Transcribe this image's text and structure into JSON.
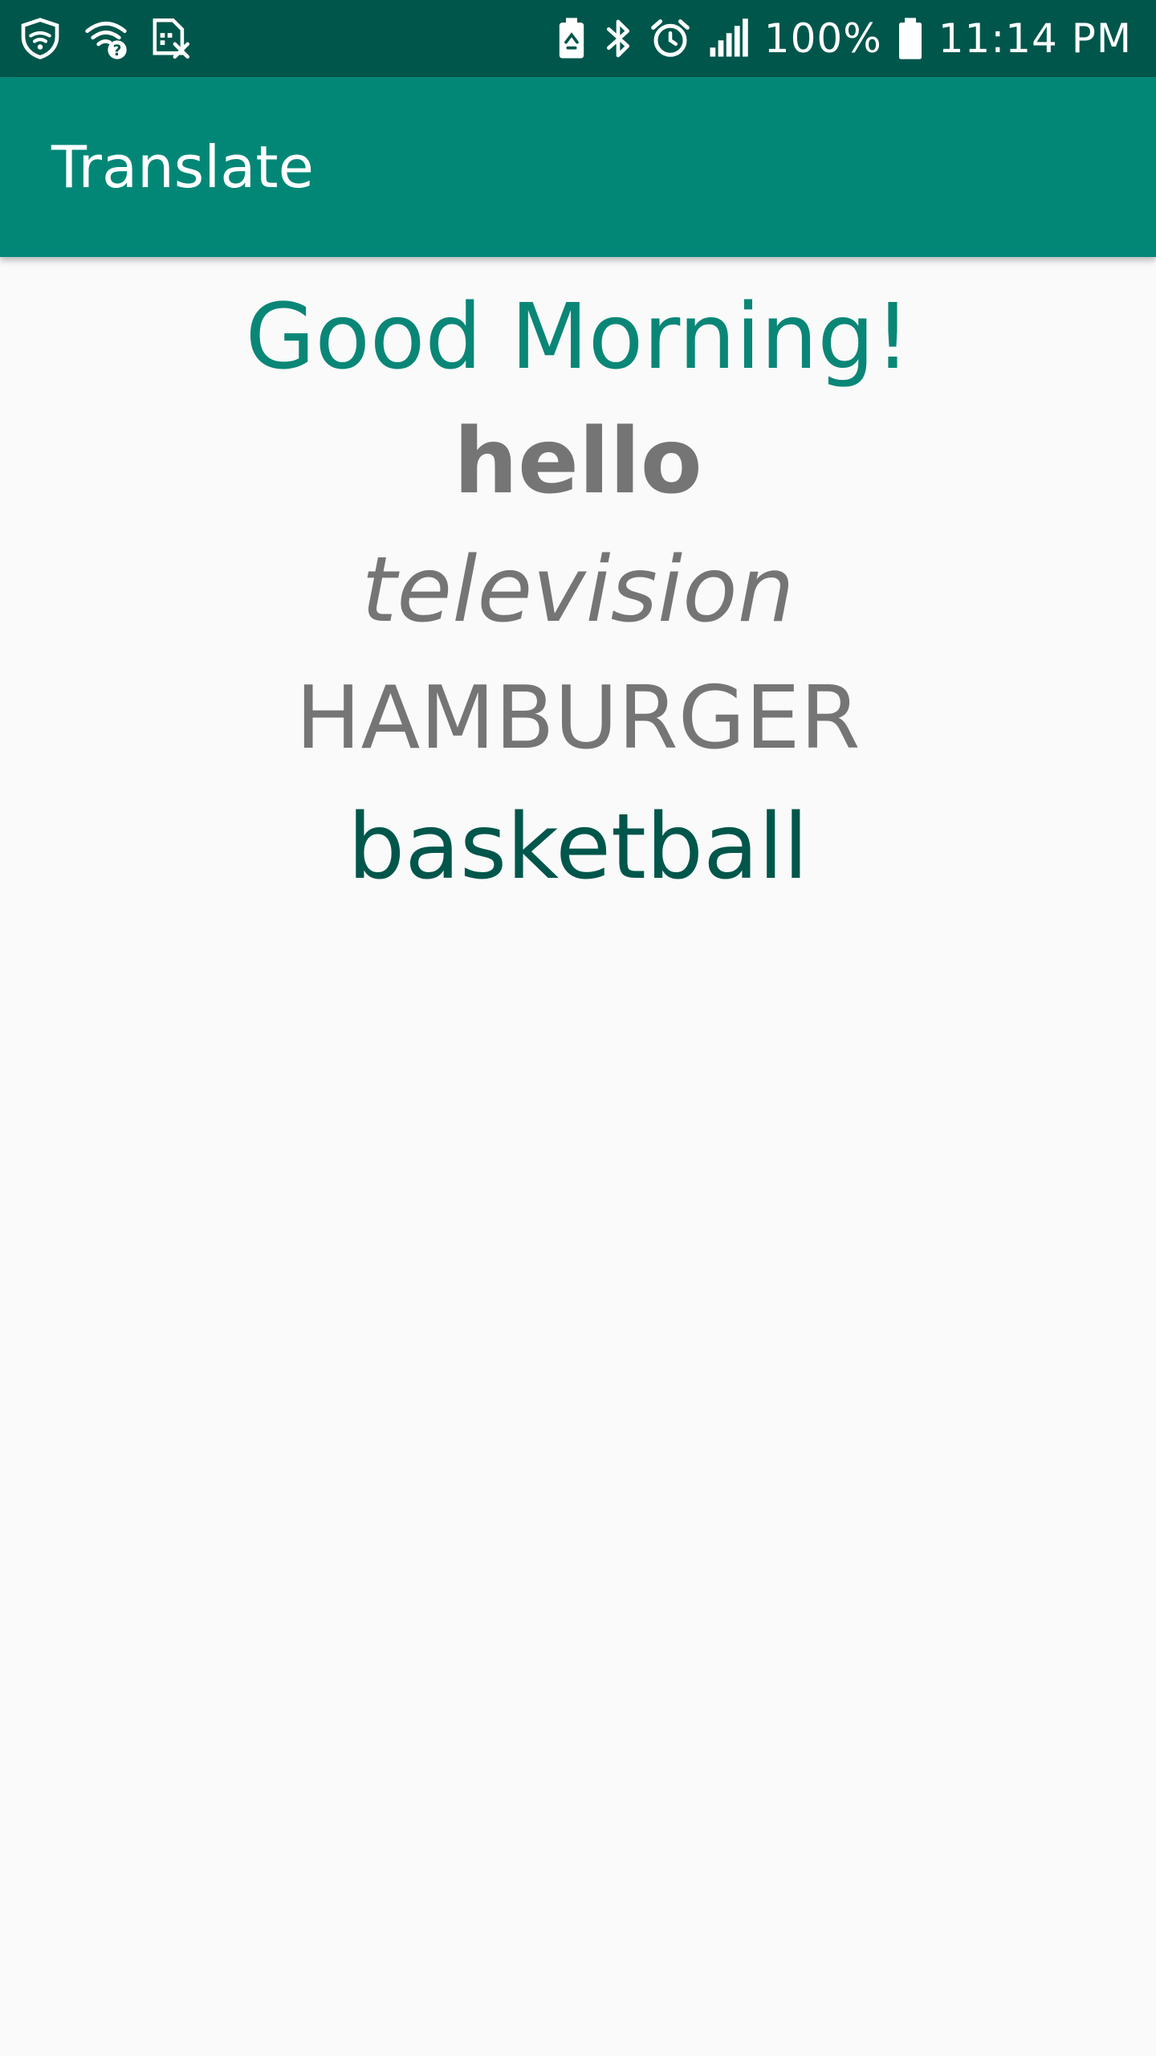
{
  "status_bar": {
    "left_icons": [
      "shield-icon",
      "wifi-question-icon",
      "sim-off-icon"
    ],
    "right_icons": [
      "battery-saver-icon",
      "bluetooth-icon",
      "alarm-icon",
      "signal-icon"
    ],
    "battery_percent": "100%",
    "time": "11:14 PM",
    "background": "#00564b"
  },
  "app_bar": {
    "title": "Translate",
    "background": "#028777"
  },
  "content": {
    "greeting": "Good Morning!",
    "words": {
      "hello": "hello",
      "television": "television",
      "hamburger": "HAMBURGER",
      "basketball": "basketball"
    }
  },
  "colors": {
    "accent": "#0a8677",
    "gray_text": "#757575",
    "dark_teal": "#00564b",
    "background": "#fafafa"
  }
}
